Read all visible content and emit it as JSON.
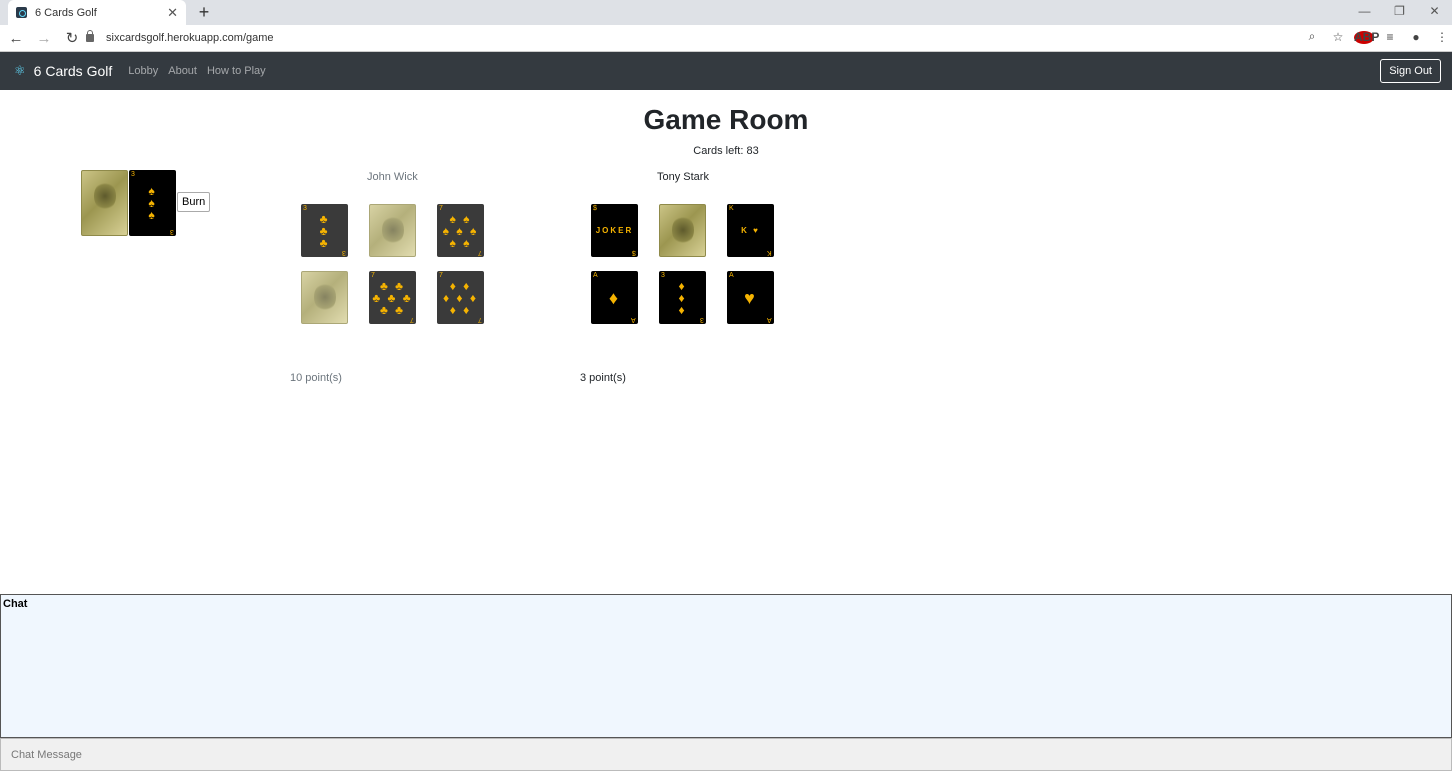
{
  "browser": {
    "tab_title": "6 Cards Golf",
    "tab_close": "✕",
    "new_tab": "+",
    "url": "sixcardsgolf.herokuapp.com/game",
    "window_controls": [
      "—",
      "❐",
      "✕"
    ]
  },
  "navbar": {
    "brand": "6 Cards Golf",
    "links": [
      "Lobby",
      "About",
      "How to Play"
    ],
    "sign_out": "Sign Out"
  },
  "game": {
    "title": "Game Room",
    "cards_left": "Cards left: 83",
    "burn_label": "Burn",
    "discard_card": {
      "rank": "3",
      "suit": "♠",
      "pips": "♠\n♠\n♠"
    }
  },
  "players": [
    {
      "name": "John Wick",
      "points": "10 point(s)",
      "cards": [
        {
          "face": true,
          "rank": "3",
          "suit": "♣",
          "pips": "♣\n♣\n♣"
        },
        {
          "face": false
        },
        {
          "face": true,
          "rank": "7",
          "suit": "♠",
          "pips": "♠ ♠\n♠ ♠ ♠\n♠ ♠"
        },
        {
          "face": false
        },
        {
          "face": true,
          "rank": "7",
          "suit": "♣",
          "pips": "♣ ♣\n♣ ♣ ♣\n♣ ♣"
        },
        {
          "face": true,
          "rank": "7",
          "suit": "♦",
          "pips": "♦ ♦\n♦ ♦ ♦\n♦ ♦"
        }
      ]
    },
    {
      "name": "Tony Stark",
      "points": "3 point(s)",
      "cards": [
        {
          "face": true,
          "rank": "$",
          "suit": "",
          "pips": "JOKER",
          "court": true
        },
        {
          "face": false
        },
        {
          "face": true,
          "rank": "K",
          "suit": "♥",
          "pips": "K ♥",
          "court": true
        },
        {
          "face": true,
          "rank": "A",
          "suit": "♦",
          "pips": "♦",
          "big": true
        },
        {
          "face": true,
          "rank": "3",
          "suit": "♦",
          "pips": "♦\n♦\n♦"
        },
        {
          "face": true,
          "rank": "A",
          "suit": "♥",
          "pips": "♥",
          "big": true
        }
      ]
    }
  ],
  "chat": {
    "title": "Chat",
    "placeholder": "Chat Message"
  }
}
